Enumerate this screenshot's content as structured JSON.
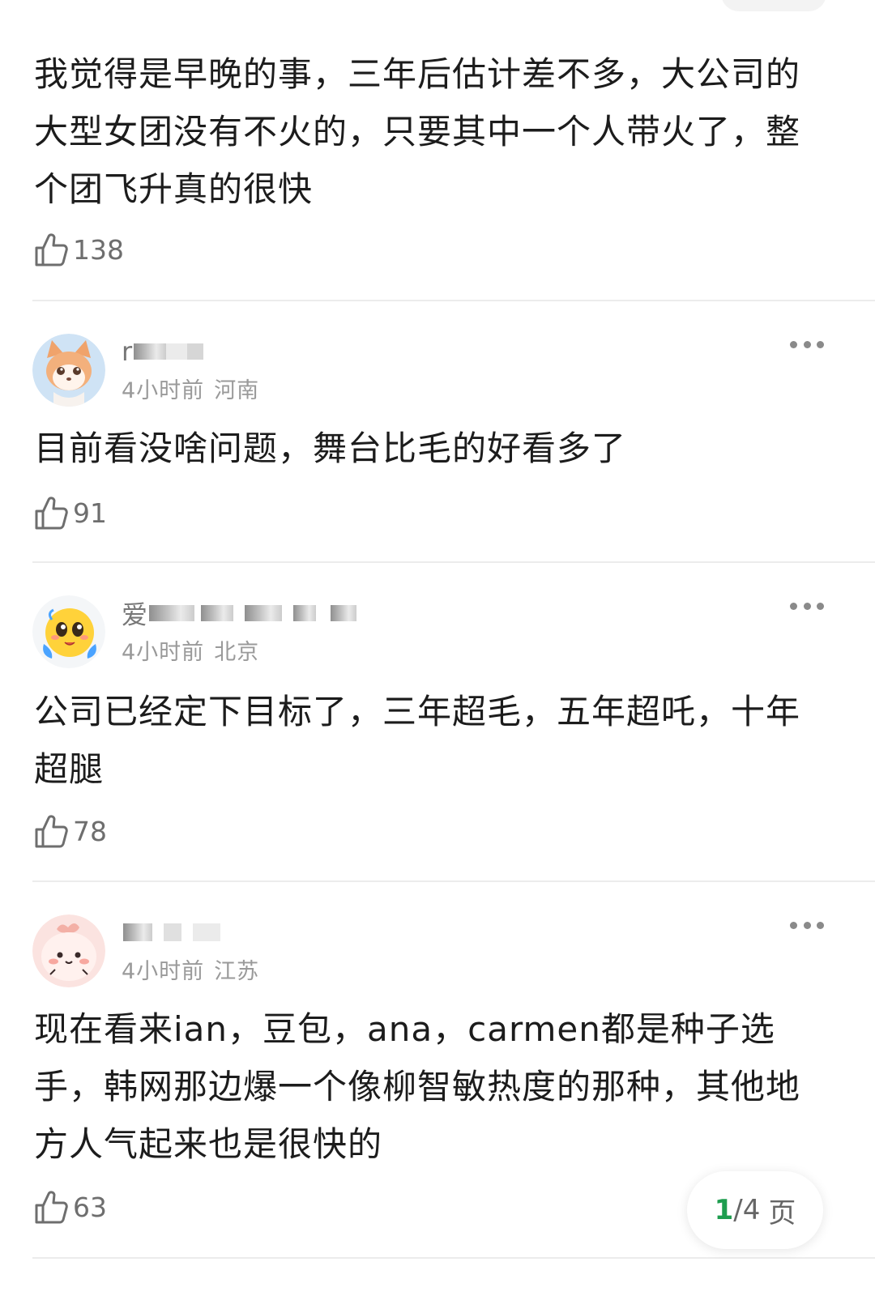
{
  "top_comment": {
    "text": "我觉得是早晚的事，三年后估计差不多，大公司的\n大型女团没有不火的，只要其中一个人带火了，整\n个团飞升真的很快",
    "likes": "138"
  },
  "comments": [
    {
      "username_prefix": "r",
      "time": "4小时前",
      "location": "河南",
      "text": "目前看没啥问题，舞台比毛的好看多了",
      "likes": "91"
    },
    {
      "username_prefix": "爱",
      "time": "4小时前",
      "location": "北京",
      "text": "公司已经定下目标了，三年超毛，五年超吒，十年\n超腿",
      "likes": "78"
    },
    {
      "username_prefix": "",
      "time": "4小时前",
      "location": "江苏",
      "text": "现在看来ian，豆包，ana，carmen都是种子选\n手，韩网那边爆一个像柳智敏热度的那种，其他地\n方人气起来也是很快的",
      "likes": "63"
    }
  ],
  "pagination": {
    "current": "1",
    "separator": "/",
    "total": "4",
    "unit": "页"
  },
  "icons": {
    "like": "thumbs-up-icon",
    "more": "more-horizontal-icon"
  },
  "colors": {
    "accent": "#1e9d4f",
    "meta": "#9a9a9a"
  }
}
